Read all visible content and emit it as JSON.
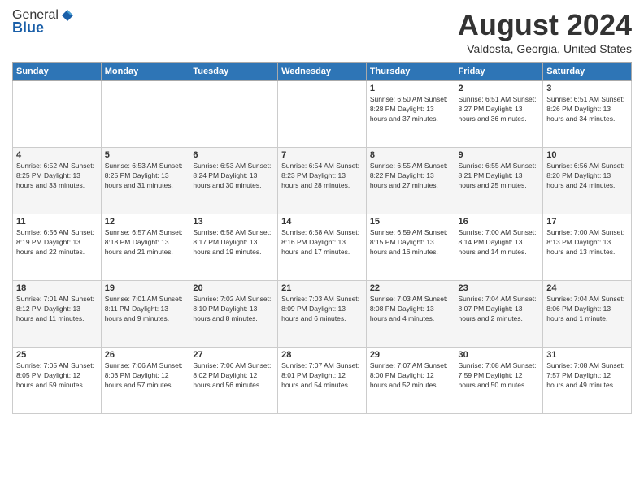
{
  "header": {
    "logo_general": "General",
    "logo_blue": "Blue",
    "title": "August 2024",
    "location": "Valdosta, Georgia, United States"
  },
  "days_of_week": [
    "Sunday",
    "Monday",
    "Tuesday",
    "Wednesday",
    "Thursday",
    "Friday",
    "Saturday"
  ],
  "weeks": [
    [
      {
        "day": "",
        "info": ""
      },
      {
        "day": "",
        "info": ""
      },
      {
        "day": "",
        "info": ""
      },
      {
        "day": "",
        "info": ""
      },
      {
        "day": "1",
        "info": "Sunrise: 6:50 AM\nSunset: 8:28 PM\nDaylight: 13 hours\nand 37 minutes."
      },
      {
        "day": "2",
        "info": "Sunrise: 6:51 AM\nSunset: 8:27 PM\nDaylight: 13 hours\nand 36 minutes."
      },
      {
        "day": "3",
        "info": "Sunrise: 6:51 AM\nSunset: 8:26 PM\nDaylight: 13 hours\nand 34 minutes."
      }
    ],
    [
      {
        "day": "4",
        "info": "Sunrise: 6:52 AM\nSunset: 8:25 PM\nDaylight: 13 hours\nand 33 minutes."
      },
      {
        "day": "5",
        "info": "Sunrise: 6:53 AM\nSunset: 8:25 PM\nDaylight: 13 hours\nand 31 minutes."
      },
      {
        "day": "6",
        "info": "Sunrise: 6:53 AM\nSunset: 8:24 PM\nDaylight: 13 hours\nand 30 minutes."
      },
      {
        "day": "7",
        "info": "Sunrise: 6:54 AM\nSunset: 8:23 PM\nDaylight: 13 hours\nand 28 minutes."
      },
      {
        "day": "8",
        "info": "Sunrise: 6:55 AM\nSunset: 8:22 PM\nDaylight: 13 hours\nand 27 minutes."
      },
      {
        "day": "9",
        "info": "Sunrise: 6:55 AM\nSunset: 8:21 PM\nDaylight: 13 hours\nand 25 minutes."
      },
      {
        "day": "10",
        "info": "Sunrise: 6:56 AM\nSunset: 8:20 PM\nDaylight: 13 hours\nand 24 minutes."
      }
    ],
    [
      {
        "day": "11",
        "info": "Sunrise: 6:56 AM\nSunset: 8:19 PM\nDaylight: 13 hours\nand 22 minutes."
      },
      {
        "day": "12",
        "info": "Sunrise: 6:57 AM\nSunset: 8:18 PM\nDaylight: 13 hours\nand 21 minutes."
      },
      {
        "day": "13",
        "info": "Sunrise: 6:58 AM\nSunset: 8:17 PM\nDaylight: 13 hours\nand 19 minutes."
      },
      {
        "day": "14",
        "info": "Sunrise: 6:58 AM\nSunset: 8:16 PM\nDaylight: 13 hours\nand 17 minutes."
      },
      {
        "day": "15",
        "info": "Sunrise: 6:59 AM\nSunset: 8:15 PM\nDaylight: 13 hours\nand 16 minutes."
      },
      {
        "day": "16",
        "info": "Sunrise: 7:00 AM\nSunset: 8:14 PM\nDaylight: 13 hours\nand 14 minutes."
      },
      {
        "day": "17",
        "info": "Sunrise: 7:00 AM\nSunset: 8:13 PM\nDaylight: 13 hours\nand 13 minutes."
      }
    ],
    [
      {
        "day": "18",
        "info": "Sunrise: 7:01 AM\nSunset: 8:12 PM\nDaylight: 13 hours\nand 11 minutes."
      },
      {
        "day": "19",
        "info": "Sunrise: 7:01 AM\nSunset: 8:11 PM\nDaylight: 13 hours\nand 9 minutes."
      },
      {
        "day": "20",
        "info": "Sunrise: 7:02 AM\nSunset: 8:10 PM\nDaylight: 13 hours\nand 8 minutes."
      },
      {
        "day": "21",
        "info": "Sunrise: 7:03 AM\nSunset: 8:09 PM\nDaylight: 13 hours\nand 6 minutes."
      },
      {
        "day": "22",
        "info": "Sunrise: 7:03 AM\nSunset: 8:08 PM\nDaylight: 13 hours\nand 4 minutes."
      },
      {
        "day": "23",
        "info": "Sunrise: 7:04 AM\nSunset: 8:07 PM\nDaylight: 13 hours\nand 2 minutes."
      },
      {
        "day": "24",
        "info": "Sunrise: 7:04 AM\nSunset: 8:06 PM\nDaylight: 13 hours\nand 1 minute."
      }
    ],
    [
      {
        "day": "25",
        "info": "Sunrise: 7:05 AM\nSunset: 8:05 PM\nDaylight: 12 hours\nand 59 minutes."
      },
      {
        "day": "26",
        "info": "Sunrise: 7:06 AM\nSunset: 8:03 PM\nDaylight: 12 hours\nand 57 minutes."
      },
      {
        "day": "27",
        "info": "Sunrise: 7:06 AM\nSunset: 8:02 PM\nDaylight: 12 hours\nand 56 minutes."
      },
      {
        "day": "28",
        "info": "Sunrise: 7:07 AM\nSunset: 8:01 PM\nDaylight: 12 hours\nand 54 minutes."
      },
      {
        "day": "29",
        "info": "Sunrise: 7:07 AM\nSunset: 8:00 PM\nDaylight: 12 hours\nand 52 minutes."
      },
      {
        "day": "30",
        "info": "Sunrise: 7:08 AM\nSunset: 7:59 PM\nDaylight: 12 hours\nand 50 minutes."
      },
      {
        "day": "31",
        "info": "Sunrise: 7:08 AM\nSunset: 7:57 PM\nDaylight: 12 hours\nand 49 minutes."
      }
    ]
  ]
}
